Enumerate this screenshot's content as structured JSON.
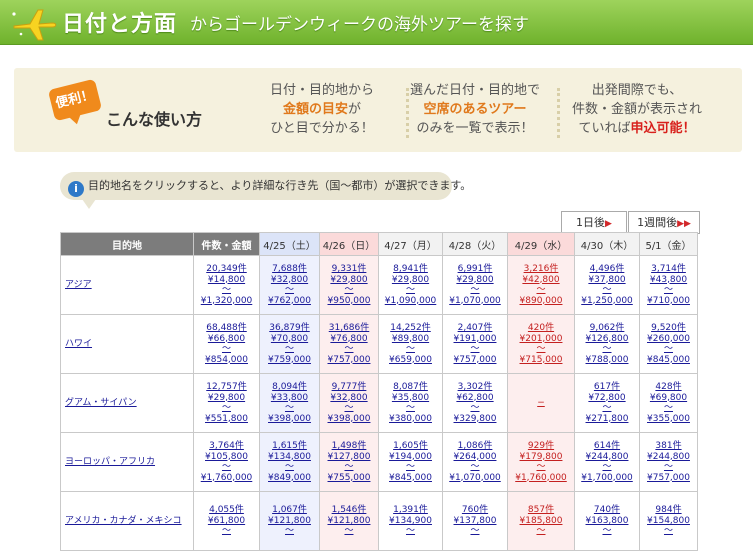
{
  "header": {
    "title": "日付と方面",
    "subtitle": "からゴールデンウィークの海外ツアーを探す"
  },
  "howto": {
    "badge": "便利！",
    "title": "こんな使い方",
    "tip1": {
      "line1": "日付・目的地から",
      "line2_hl": "金額の目安",
      "line2_rest": "が",
      "line3": "ひと目で分かる！"
    },
    "tip2": {
      "line1": "選んだ日付・目的地で",
      "line2_hl": "空席のあるツアー",
      "line3": "のみを一覧で表示！"
    },
    "tip3": {
      "line1": "出発間際でも、",
      "line2": "件数・金額が表示され",
      "line3_pre": "ていれば",
      "line3_red": "申込可能！"
    }
  },
  "info": {
    "icon": "i",
    "text": "目的地名をクリックすると、より詳細な行き先（国〜都市）が選択できます。"
  },
  "pager": {
    "next_day": "1日後",
    "next_week": "1週間後",
    "arrow1": "▶",
    "arrow2": "▶▶"
  },
  "table": {
    "col_dest": "目的地",
    "col_summary": "件数・金額",
    "dates": [
      "4/25（土）",
      "4/26（日）",
      "4/27（月）",
      "4/28（火）",
      "4/29（水）",
      "4/30（木）",
      "5/1（金）"
    ],
    "rows": [
      {
        "dest": "アジア",
        "summary": [
          "20,349件",
          "¥14,800",
          "〜",
          "¥1,320,000"
        ],
        "cells": [
          [
            "7,688件",
            "¥32,800",
            "〜",
            "¥762,000"
          ],
          [
            "9,331件",
            "¥29,800",
            "〜",
            "¥950,000"
          ],
          [
            "8,941件",
            "¥29,800",
            "〜",
            "¥1,090,000"
          ],
          [
            "6,991件",
            "¥29,800",
            "〜",
            "¥1,070,000"
          ],
          [
            "3,216件",
            "¥42,800",
            "〜",
            "¥890,000"
          ],
          [
            "4,496件",
            "¥37,800",
            "〜",
            "¥1,250,000"
          ],
          [
            "3,714件",
            "¥43,800",
            "〜",
            "¥710,000"
          ]
        ]
      },
      {
        "dest": "ハワイ",
        "summary": [
          "68,488件",
          "¥66,800",
          "〜",
          "¥854,000"
        ],
        "cells": [
          [
            "36,879件",
            "¥70,800",
            "〜",
            "¥759,000"
          ],
          [
            "31,686件",
            "¥76,800",
            "〜",
            "¥757,000"
          ],
          [
            "14,252件",
            "¥89,800",
            "〜",
            "¥659,000"
          ],
          [
            "2,407件",
            "¥191,000",
            "〜",
            "¥757,000"
          ],
          [
            "420件",
            "¥201,000",
            "〜",
            "¥715,000"
          ],
          [
            "9,062件",
            "¥126,800",
            "〜",
            "¥788,000"
          ],
          [
            "9,520件",
            "¥260,000",
            "〜",
            "¥845,000"
          ]
        ]
      },
      {
        "dest": "グアム・サイパン",
        "summary": [
          "12,757件",
          "¥29,800",
          "〜",
          "¥551,800"
        ],
        "cells": [
          [
            "8,094件",
            "¥33,800",
            "〜",
            "¥398,000"
          ],
          [
            "9,777件",
            "¥32,800",
            "〜",
            "¥398,000"
          ],
          [
            "8,087件",
            "¥35,800",
            "〜",
            "¥380,000"
          ],
          [
            "3,302件",
            "¥62,800",
            "〜",
            "¥329,800"
          ],
          [
            "−"
          ],
          [
            "617件",
            "¥72,800",
            "〜",
            "¥271,800"
          ],
          [
            "428件",
            "¥69,800",
            "〜",
            "¥355,000"
          ]
        ]
      },
      {
        "dest": "ヨーロッパ・アフリカ",
        "summary": [
          "3,764件",
          "¥105,800",
          "〜",
          "¥1,760,000"
        ],
        "cells": [
          [
            "1,615件",
            "¥134,800",
            "〜",
            "¥849,000"
          ],
          [
            "1,498件",
            "¥127,800",
            "〜",
            "¥755,000"
          ],
          [
            "1,605件",
            "¥194,000",
            "〜",
            "¥845,000"
          ],
          [
            "1,086件",
            "¥264,000",
            "〜",
            "¥1,070,000"
          ],
          [
            "929件",
            "¥179,800",
            "〜",
            "¥1,760,000"
          ],
          [
            "614件",
            "¥244,800",
            "〜",
            "¥1,700,000"
          ],
          [
            "381件",
            "¥244,800",
            "〜",
            "¥757,000"
          ]
        ]
      },
      {
        "dest": "アメリカ・カナダ・メキシコ",
        "summary": [
          "4,055件",
          "¥61,800",
          "〜",
          ""
        ],
        "cells": [
          [
            "1,067件",
            "¥121,800",
            "〜",
            ""
          ],
          [
            "1,546件",
            "¥121,800",
            "〜",
            ""
          ],
          [
            "1,391件",
            "¥134,900",
            "〜",
            ""
          ],
          [
            "760件",
            "¥137,800",
            "〜",
            ""
          ],
          [
            "857件",
            "¥185,800",
            "〜",
            ""
          ],
          [
            "740件",
            "¥163,800",
            "〜",
            ""
          ],
          [
            "984件",
            "¥154,800",
            "〜",
            ""
          ]
        ]
      }
    ]
  }
}
